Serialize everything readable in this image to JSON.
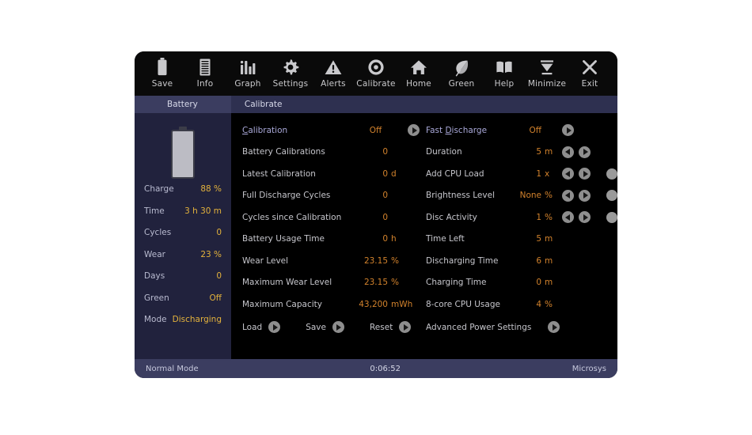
{
  "toolbar": {
    "items": [
      {
        "label": "Save",
        "icon": "battery-icon"
      },
      {
        "label": "Info",
        "icon": "document-icon"
      },
      {
        "label": "Graph",
        "icon": "bar-chart-icon"
      },
      {
        "label": "Settings",
        "icon": "gear-icon"
      },
      {
        "label": "Alerts",
        "icon": "warning-triangle-icon"
      },
      {
        "label": "Calibrate",
        "icon": "target-circle-icon"
      },
      {
        "label": "Home",
        "icon": "home-icon"
      },
      {
        "label": "Green",
        "icon": "leaf-icon"
      },
      {
        "label": "Help",
        "icon": "book-icon"
      },
      {
        "label": "Minimize",
        "icon": "minimize-icon"
      },
      {
        "label": "Exit",
        "icon": "close-x-icon"
      }
    ]
  },
  "tabs": [
    {
      "label": "Battery",
      "selected": true
    },
    {
      "label": "Calibrate",
      "selected": false
    }
  ],
  "sidebar": {
    "battery_icon": "battery-vertical-icon",
    "rows": [
      {
        "label": "Charge",
        "value": "88 %"
      },
      {
        "label": "Time",
        "value": "3 h 30 m"
      },
      {
        "label": "Cycles",
        "value": "0"
      },
      {
        "label": "Wear",
        "value": "23 %"
      },
      {
        "label": "Days",
        "value": "0"
      },
      {
        "label": "Green",
        "value": "Off"
      },
      {
        "label": "Mode",
        "value": "Discharging"
      }
    ]
  },
  "calibration_panel": {
    "header": {
      "label_pre": "C",
      "label_post": "alibration",
      "value": "Off",
      "unit": "",
      "button": "play-icon"
    },
    "rows": [
      {
        "label": "Battery Calibrations",
        "value": "0",
        "unit": ""
      },
      {
        "label": "Latest Calibration",
        "value": "0",
        "unit": "d"
      },
      {
        "label": "Full Discharge Cycles",
        "value": "0",
        "unit": ""
      },
      {
        "label": "Cycles since Calibration",
        "value": "0",
        "unit": ""
      },
      {
        "label": "Battery Usage Time",
        "value": "0",
        "unit": "h"
      },
      {
        "label": "Wear Level",
        "value": "23.15",
        "unit": "%"
      },
      {
        "label": "Maximum Wear Level",
        "value": "23.15",
        "unit": "%"
      },
      {
        "label": "Maximum Capacity",
        "value": "43,200",
        "unit": "mWh"
      }
    ],
    "actions": [
      {
        "label": "Load",
        "button": "play-icon"
      },
      {
        "label": "Save",
        "button": "play-icon"
      },
      {
        "label": "Reset",
        "button": "play-icon"
      }
    ]
  },
  "discharge_panel": {
    "header": {
      "label_pre": "Fast ",
      "label_acc": "D",
      "label_post": "ischarge",
      "value": "Off",
      "unit": "",
      "button": "play-icon"
    },
    "rows": [
      {
        "label": "Duration",
        "value": "5",
        "unit": "m",
        "controls": "arrows"
      },
      {
        "label": "Add CPU Load",
        "value": "1",
        "unit": "x",
        "controls": "arrows-dot"
      },
      {
        "label": "Brightness Level",
        "value": "None",
        "unit": "%",
        "controls": "arrows-dot"
      },
      {
        "label": "Disc Activity",
        "value": "1",
        "unit": "%",
        "controls": "arrows-dot"
      },
      {
        "label": "Time Left",
        "value": "5",
        "unit": "m",
        "controls": "none"
      },
      {
        "label": "Discharging Time",
        "value": "6",
        "unit": "m",
        "controls": "none"
      },
      {
        "label": "Charging Time",
        "value": "0",
        "unit": "m",
        "controls": "none"
      },
      {
        "label": "8-core CPU Usage",
        "value": "4",
        "unit": "%",
        "controls": "none"
      }
    ],
    "advanced": {
      "label": "Advanced Power Settings",
      "button": "play-icon"
    }
  },
  "statusbar": {
    "mode": "Normal Mode",
    "timer": "0:06:52",
    "vendor": "Microsys"
  },
  "colors": {
    "window_bg": "#05070c",
    "toolbar_bg": "#0a0a0a",
    "tabstrip_bg": "#2e3050",
    "tab_selected_bg": "#3b3d60",
    "sidebar_bg": "#21223d",
    "panel_bg": "#000000",
    "statusbar_bg": "#3b3d60",
    "value_amber": "#d2822c",
    "sidebar_value": "#e3b23c",
    "label_grey": "#c6c6cc",
    "accent_lavender": "#a9a8d8",
    "button_grey": "#8e8e8e"
  }
}
